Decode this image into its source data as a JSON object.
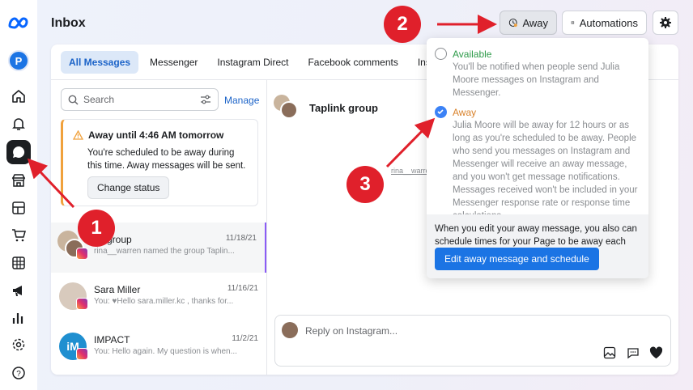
{
  "header": {
    "title": "Inbox",
    "away_label": "Away",
    "automations_label": "Automations"
  },
  "rail": {
    "profile_initial": "P",
    "items": [
      "home-icon",
      "bell-icon",
      "chat-icon",
      "shop-icon",
      "pages-icon",
      "cart-icon",
      "table-icon",
      "megaphone-icon",
      "chart-icon",
      "settings-icon",
      "help-icon"
    ]
  },
  "tabs": [
    "All Messages",
    "Messenger",
    "Instagram Direct",
    "Facebook comments",
    "Insta"
  ],
  "search": {
    "placeholder": "Search",
    "manage_label": "Manage"
  },
  "away_notice": {
    "title": "Away until 4:46 AM tomorrow",
    "description": "You're scheduled to be away during this time. Away messages will be sent.",
    "button": "Change status"
  },
  "conversations": [
    {
      "name": "nk group",
      "date": "11/18/21",
      "preview": "rina__warren named the group Taplin..."
    },
    {
      "name": "Sara Miller",
      "date": "11/16/21",
      "preview": "You: ♥Hello sara.miller.kc , thanks for..."
    },
    {
      "name": "IMPACT",
      "date": "11/2/21",
      "preview": "You: Hello again. My question is when..."
    }
  ],
  "chat": {
    "group_name": "Taplink group",
    "member_handle": "rina__warren",
    "reply_placeholder": "Reply on Instagram..."
  },
  "away_menu": {
    "available_title": "Available",
    "available_desc": "You'll be notified when people send Julia Moore messages on Instagram and Messenger.",
    "away_title": "Away",
    "away_desc": "Julia Moore will be away for 12 hours or as long as you're scheduled to be away. People who send you messages on Instagram and Messenger will receive an away message, and you won't get message notifications. Messages received won't be included in your Messenger response rate or response time calculations.",
    "footer_text": "When you edit your away message, you also can schedule times for your Page to be away each week.",
    "edit_button": "Edit away message and schedule",
    "selected": "Away"
  },
  "annotations": [
    "1",
    "2",
    "3"
  ],
  "colors": {
    "accent": "#1b74e4",
    "marker": "#e0202b",
    "away_warning": "#f0a13c"
  }
}
